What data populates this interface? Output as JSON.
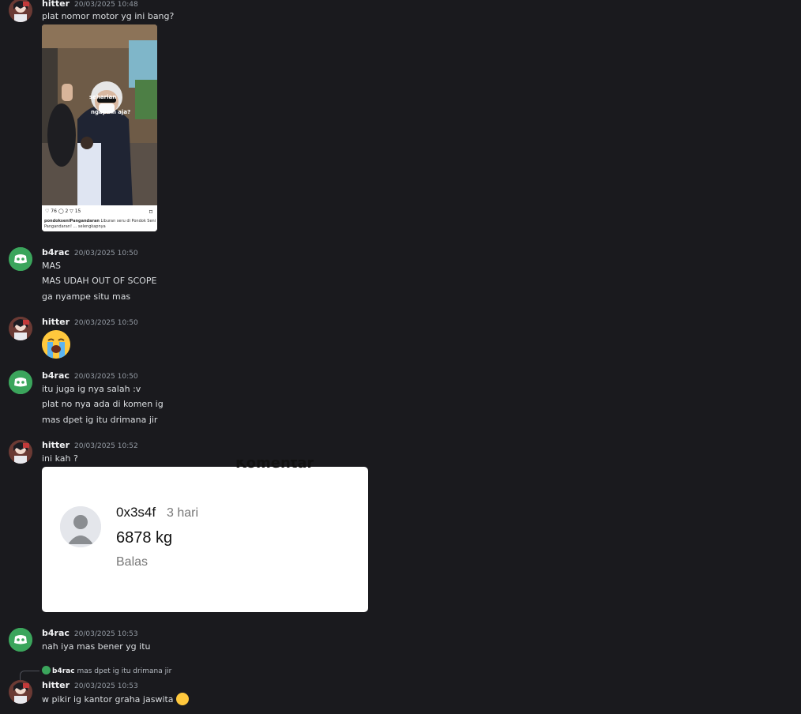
{
  "messages": [
    {
      "author": "hitter",
      "timestamp": "20/03/2025 10:48",
      "lines": [
        "plat nomor motor yg ini bang?"
      ],
      "image": {
        "overlay_text_1": "seharian",
        "overlay_text_2": "ngapain aja?",
        "stats": "♡ 76   ◯ 2   ▽ 15",
        "caption_user": "pondokseniPangandaran",
        "caption_text": "Liburan seru di Pondok Seni Pangandaran! ... selengkapnya"
      }
    },
    {
      "author": "b4rac",
      "timestamp": "20/03/2025 10:50",
      "lines": [
        "MAS",
        "MAS UDAH OUT OF SCOPE",
        "ga nyampe situ mas"
      ]
    },
    {
      "author": "hitter",
      "timestamp": "20/03/2025 10:50",
      "emoji": "loudly-crying-face"
    },
    {
      "author": "b4rac",
      "timestamp": "20/03/2025 10:50",
      "lines": [
        "itu juga ig nya salah :v",
        "plat no nya ada di komen ig",
        "mas dpet ig itu drimana jir"
      ]
    },
    {
      "author": "hitter",
      "timestamp": "20/03/2025 10:52",
      "lines": [
        "ini kah ?"
      ],
      "comment_card": {
        "title": "Komentar",
        "user": "0x3s4f",
        "time": "3 hari",
        "text": "6878 kg",
        "reply": "Balas"
      }
    },
    {
      "author": "b4rac",
      "timestamp": "20/03/2025 10:53",
      "lines": [
        "nah iya mas bener yg itu"
      ]
    },
    {
      "author": "hitter",
      "timestamp": "20/03/2025 10:53",
      "reply_to": {
        "author": "b4rac",
        "text": "mas dpet ig itu drimana jir"
      },
      "lines": [
        "w pikir ig kantor graha jaswita"
      ],
      "trailing_emoji": "loudly-crying-face"
    }
  ],
  "colors": {
    "background": "#1a1a1e",
    "username": "#f2f3f5",
    "timestamp": "#949ba4",
    "bot_avatar": "#3ba55c"
  }
}
